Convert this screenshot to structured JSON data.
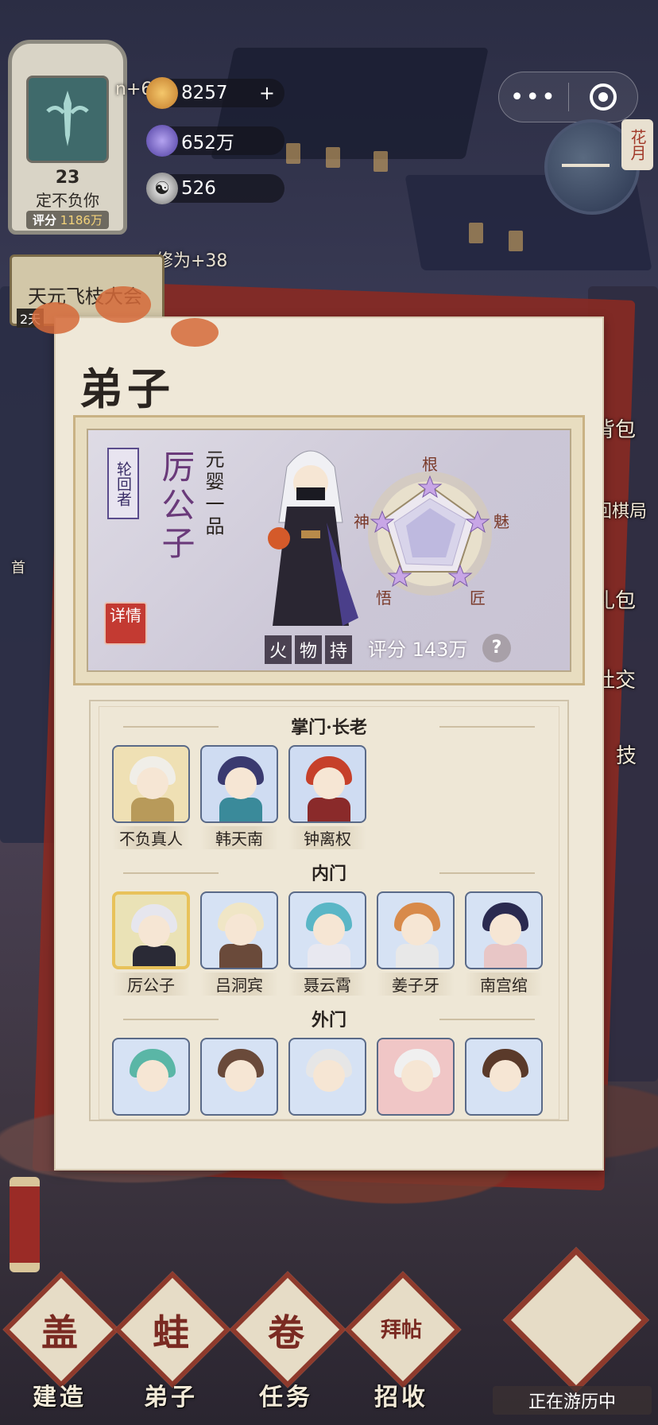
{
  "player": {
    "level": "23",
    "name": "定不负你",
    "score_label": "评分",
    "score_value": "1186万"
  },
  "resources": [
    {
      "icon": "gold-coin-icon",
      "value": "8257",
      "action": "+"
    },
    {
      "icon": "spirit-crystal-icon",
      "value": "652万"
    },
    {
      "icon": "yinyang-icon",
      "value": "526"
    }
  ],
  "background_text": {
    "prefix": "n+6",
    "cultivation": "修为+38"
  },
  "clock": {
    "badge": "花月"
  },
  "event": {
    "title": "天元飞枝大会",
    "days": "2天"
  },
  "side_buttons": [
    "背包",
    "回棋局",
    "礼包",
    "社交",
    "技"
  ],
  "left_hint": "首",
  "panel": {
    "title": "弟子",
    "selected": {
      "rank_seal": "轮回者",
      "name": "厉公子",
      "realm": "元婴一品",
      "detail_label": "详情",
      "traits": [
        "火",
        "物",
        "持"
      ],
      "score": "评分 143万",
      "help": "?",
      "radar_labels": [
        "根",
        "魅",
        "匠",
        "悟",
        "神"
      ]
    },
    "sections": [
      {
        "title": "掌门·长老",
        "disciples": [
          {
            "name": "不负真人",
            "bg": "#efe0b4",
            "hair": "#f0eee8",
            "body": "#b89a5a"
          },
          {
            "name": "韩天南",
            "bg": "#cfdcf2",
            "hair": "#3a3a70",
            "body": "#3a8a9a"
          },
          {
            "name": "钟离权",
            "bg": "#cfdcf2",
            "hair": "#c6402a",
            "body": "#8a2a2a"
          }
        ]
      },
      {
        "title": "内门",
        "disciples": [
          {
            "name": "厉公子",
            "bg": "#eae2b6",
            "hair": "#e6e6ee",
            "body": "#2a2a36",
            "selected": true
          },
          {
            "name": "吕洞宾",
            "bg": "#d6e2f4",
            "hair": "#f0e6c6",
            "body": "#6a4a3a"
          },
          {
            "name": "聂云霄",
            "bg": "#d6e2f4",
            "hair": "#5ab6c6",
            "body": "#e8e8f0"
          },
          {
            "name": "姜子牙",
            "bg": "#d6e2f4",
            "hair": "#d88a4a",
            "body": "#e8e8e8"
          },
          {
            "name": "南宫绾",
            "bg": "#d6e2f4",
            "hair": "#2a2a50",
            "body": "#e8c6c6"
          }
        ]
      },
      {
        "title": "外门",
        "disciples": [
          {
            "name": "",
            "bg": "#d6e2f4",
            "hair": "#5ab6a6",
            "body": "#d6e2f4"
          },
          {
            "name": "",
            "bg": "#d6e2f4",
            "hair": "#6a4a3a",
            "body": "#d6e2f4"
          },
          {
            "name": "",
            "bg": "#d6e2f4",
            "hair": "#e6e6e6",
            "body": "#d6e2f4"
          },
          {
            "name": "",
            "bg": "#f0c6c6",
            "hair": "#f0f0f0",
            "body": "#f0c6c6"
          },
          {
            "name": "",
            "bg": "#d6e2f4",
            "hair": "#5a3a2a",
            "body": "#d6e2f4"
          }
        ]
      }
    ]
  },
  "nav": [
    {
      "label": "建造",
      "glyph": "盖",
      "icon": "build-icon"
    },
    {
      "label": "弟子",
      "glyph": "蛙",
      "icon": "disciple-icon"
    },
    {
      "label": "任务",
      "glyph": "卷",
      "icon": "task-scroll-icon"
    },
    {
      "label": "招收",
      "glyph": "拜帖",
      "icon": "recruit-card-icon"
    }
  ],
  "travel": {
    "label": "正在游历中",
    "icon": "travel-cloud-icon"
  },
  "colors": {
    "accent_red": "#8e3a2c",
    "panel_bg": "#efe8d8",
    "gold": "#e8c25a"
  }
}
